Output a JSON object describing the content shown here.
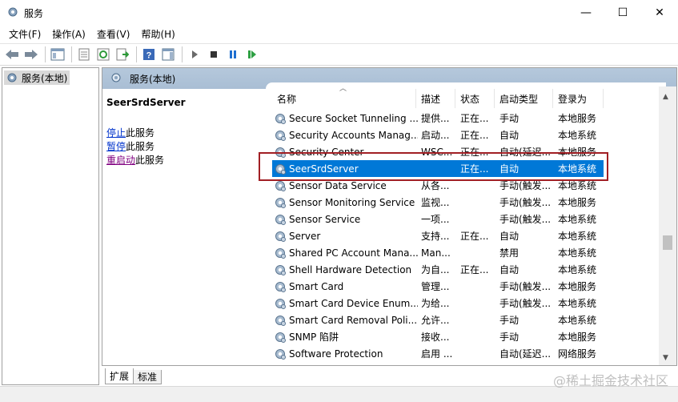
{
  "window": {
    "title": "服务",
    "min_glyph": "—",
    "max_glyph": "☐",
    "close_glyph": "✕"
  },
  "menu": [
    "文件(F)",
    "操作(A)",
    "查看(V)",
    "帮助(H)"
  ],
  "toolbar": {
    "icons": [
      "back-arrow-icon",
      "forward-arrow-icon",
      "show-hide-tree-icon",
      "properties-icon",
      "refresh-icon",
      "export-list-icon",
      "help-icon",
      "show-action-pane-icon",
      "start-service-icon",
      "stop-service-icon",
      "pause-service-icon",
      "restart-service-icon"
    ]
  },
  "tree": {
    "root_label": "服务(本地)"
  },
  "right_header": {
    "title": "服务(本地)"
  },
  "description": {
    "service_name": "SeerSrdServer",
    "stop_link": "停止",
    "stop_suffix": "此服务",
    "pause_link": "暂停",
    "pause_suffix": "此服务",
    "restart_link": "重启动",
    "restart_suffix": "此服务"
  },
  "list": {
    "columns": [
      "名称",
      "描述",
      "状态",
      "启动类型",
      "登录为"
    ],
    "rows": [
      {
        "name": "Secure Socket Tunneling ...",
        "desc": "提供...",
        "status": "正在...",
        "startup": "手动",
        "logon": "本地服务"
      },
      {
        "name": "Security Accounts Manag...",
        "desc": "启动...",
        "status": "正在...",
        "startup": "自动",
        "logon": "本地系统"
      },
      {
        "name": "Security Center",
        "desc": "WSC...",
        "status": "正在...",
        "startup": "自动(延迟...",
        "logon": "本地服务"
      },
      {
        "name": "SeerSrdServer",
        "desc": "",
        "status": "正在...",
        "startup": "自动",
        "logon": "本地系统",
        "selected": true
      },
      {
        "name": "Sensor Data Service",
        "desc": "从各...",
        "status": "",
        "startup": "手动(触发...",
        "logon": "本地系统"
      },
      {
        "name": "Sensor Monitoring Service",
        "desc": "监视...",
        "status": "",
        "startup": "手动(触发...",
        "logon": "本地服务"
      },
      {
        "name": "Sensor Service",
        "desc": "一项...",
        "status": "",
        "startup": "手动(触发...",
        "logon": "本地系统"
      },
      {
        "name": "Server",
        "desc": "支持...",
        "status": "正在...",
        "startup": "自动",
        "logon": "本地系统"
      },
      {
        "name": "Shared PC Account Mana...",
        "desc": "Man...",
        "status": "",
        "startup": "禁用",
        "logon": "本地系统"
      },
      {
        "name": "Shell Hardware Detection",
        "desc": "为自...",
        "status": "正在...",
        "startup": "自动",
        "logon": "本地系统"
      },
      {
        "name": "Smart Card",
        "desc": "管理...",
        "status": "",
        "startup": "手动(触发...",
        "logon": "本地服务"
      },
      {
        "name": "Smart Card Device Enum...",
        "desc": "为给...",
        "status": "",
        "startup": "手动(触发...",
        "logon": "本地系统"
      },
      {
        "name": "Smart Card Removal Poli...",
        "desc": "允许...",
        "status": "",
        "startup": "手动",
        "logon": "本地系统"
      },
      {
        "name": "SNMP 陷阱",
        "desc": "接收...",
        "status": "",
        "startup": "手动",
        "logon": "本地服务"
      },
      {
        "name": "Software Protection",
        "desc": "启用 ...",
        "status": "",
        "startup": "自动(延迟...",
        "logon": "网络服务"
      }
    ]
  },
  "tabs": [
    "扩展",
    "标准"
  ],
  "watermark": "@稀土掘金技术社区",
  "colors": {
    "selection": "#0078d7",
    "highlight_box": "#a11f24",
    "link": "#0033cc",
    "header_band": "#b0c4da"
  }
}
